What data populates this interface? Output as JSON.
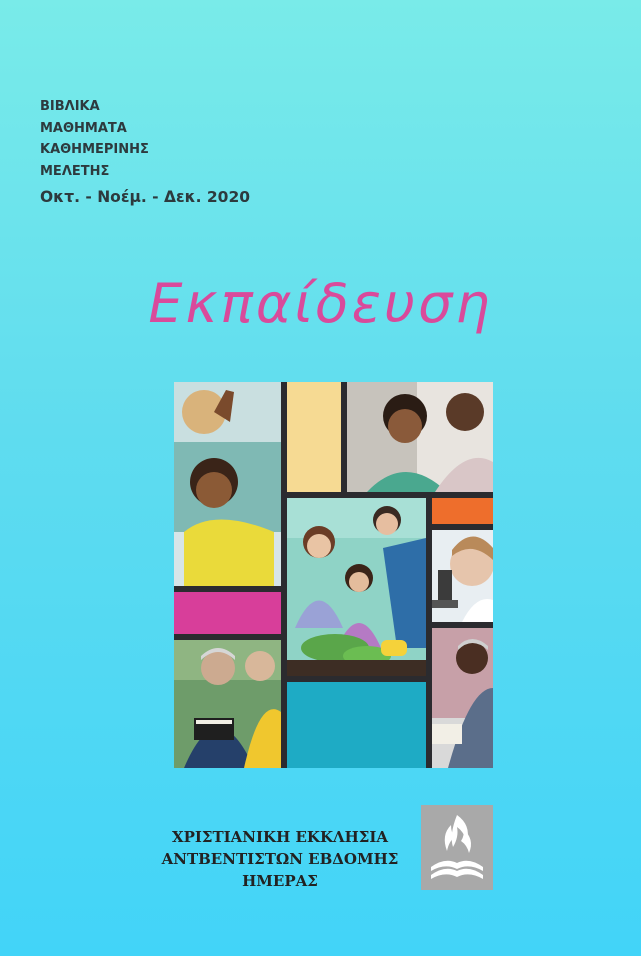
{
  "header": {
    "series_lines": [
      "ΒΙΒΛΙΚΑ",
      "ΜΑΘΗΜΑΤΑ",
      "ΚΑΘΗΜΕΡΙΝΗΣ",
      "ΜΕΛΕΤΗΣ"
    ],
    "quarter": "Οκτ. - Νοέμ. - Δεκ. 2020"
  },
  "cover": {
    "title": "Εκπαίδευση",
    "title_color": "#d94a9b"
  },
  "collage": {
    "colors": {
      "yellow": "#f6da93",
      "orange": "#ee6e2c",
      "magenta": "#d83e9a",
      "teal": "#1eabc5",
      "frame": "#2b2b2f"
    }
  },
  "footer": {
    "org_lines": [
      "ΧΡΙΣΤΙΑΝΙΚΗ ΕΚΚΛΗΣΙΑ",
      "ΑΝΤΒΕΝΤΙΣΤΩΝ ΕΒΔΟΜΗΣ",
      "ΗΜΕΡΑΣ"
    ],
    "logo_icon": "adventist-flame-book-icon"
  }
}
